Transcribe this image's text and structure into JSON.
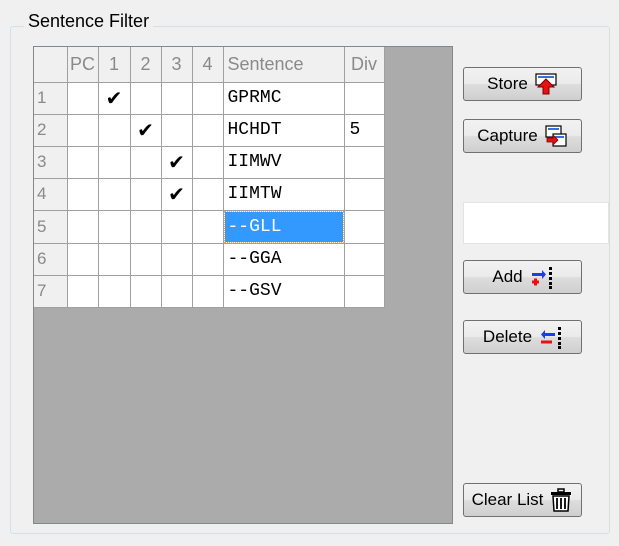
{
  "group": {
    "title": "Sentence Filter"
  },
  "grid": {
    "headers": [
      "",
      "PC",
      "1",
      "2",
      "3",
      "4",
      "Sentence",
      "Div"
    ],
    "rows": [
      {
        "num": "1",
        "pc": "",
        "c1": "✔",
        "c2": "",
        "c3": "",
        "c4": "",
        "sentence": "GPRMC",
        "div": ""
      },
      {
        "num": "2",
        "pc": "",
        "c1": "",
        "c2": "✔",
        "c3": "",
        "c4": "",
        "sentence": "HCHDT",
        "div": "5"
      },
      {
        "num": "3",
        "pc": "",
        "c1": "",
        "c2": "",
        "c3": "✔",
        "c4": "",
        "sentence": "IIMWV",
        "div": ""
      },
      {
        "num": "4",
        "pc": "",
        "c1": "",
        "c2": "",
        "c3": "✔",
        "c4": "",
        "sentence": "IIMTW",
        "div": ""
      },
      {
        "num": "5",
        "pc": "",
        "c1": "",
        "c2": "",
        "c3": "",
        "c4": "",
        "sentence": "--GLL",
        "div": ""
      },
      {
        "num": "6",
        "pc": "",
        "c1": "",
        "c2": "",
        "c3": "",
        "c4": "",
        "sentence": "--GGA",
        "div": ""
      },
      {
        "num": "7",
        "pc": "",
        "c1": "",
        "c2": "",
        "c3": "",
        "c4": "",
        "sentence": "--GSV",
        "div": ""
      }
    ],
    "selected_row": "5"
  },
  "buttons": {
    "store": {
      "label": "Store",
      "icon": "store-arrow-icon"
    },
    "capture": {
      "label": "Capture",
      "icon": "capture-icon"
    },
    "add": {
      "label": "Add",
      "icon": "add-arrow-icon"
    },
    "delete": {
      "label": "Delete",
      "icon": "delete-arrow-icon"
    },
    "clear": {
      "label": "Clear List",
      "icon": "trash-icon"
    }
  },
  "input": {
    "value": ""
  }
}
